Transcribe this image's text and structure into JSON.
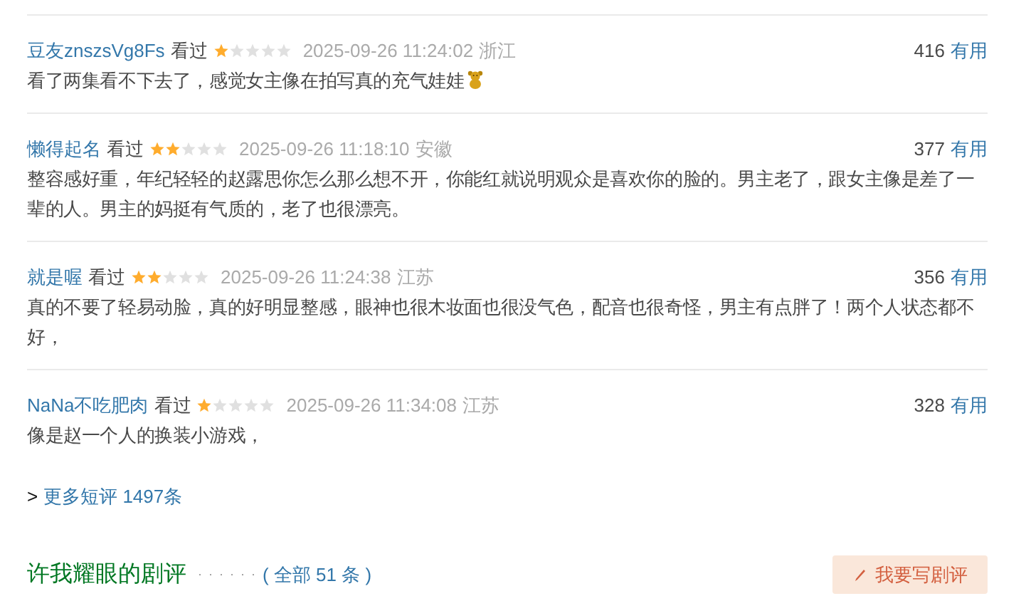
{
  "comments": [
    {
      "user": "豆友znszsVg8Fs",
      "status": "看过",
      "stars": 1,
      "time": "2025-09-26 11:24:02",
      "location": "浙江",
      "votes": "416",
      "useful": "有用",
      "text": "看了两集看不下去了，感觉女主像在拍写真的充气娃娃",
      "emoji": true
    },
    {
      "user": "懒得起名",
      "status": "看过",
      "stars": 2,
      "time": "2025-09-26 11:18:10",
      "location": "安徽",
      "votes": "377",
      "useful": "有用",
      "text": "整容感好重，年纪轻轻的赵露思你怎么那么想不开，你能红就说明观众是喜欢你的脸的。男主老了，跟女主像是差了一辈的人。男主的妈挺有气质的，老了也很漂亮。",
      "emoji": false
    },
    {
      "user": "就是喔",
      "status": "看过",
      "stars": 2,
      "time": "2025-09-26 11:24:38",
      "location": "江苏",
      "votes": "356",
      "useful": "有用",
      "text": "真的不要了轻易动脸，真的好明显整感，眼神也很木妆面也很没气色，配音也很奇怪，男主有点胖了！两个人状态都不好，",
      "emoji": false
    },
    {
      "user": "NaNa不吃肥肉",
      "status": "看过",
      "stars": 1,
      "time": "2025-09-26 11:34:08",
      "location": "江苏",
      "votes": "328",
      "useful": "有用",
      "text": "像是赵一个人的换装小游戏，",
      "emoji": false
    }
  ],
  "more_link": {
    "arrow": ">",
    "label": "更多短评 1497条"
  },
  "reviews_section": {
    "title": "许我耀眼的剧评",
    "dots": "· · · · · ·",
    "count": "( 全部 51 条 )",
    "write_button": "我要写剧评"
  }
}
